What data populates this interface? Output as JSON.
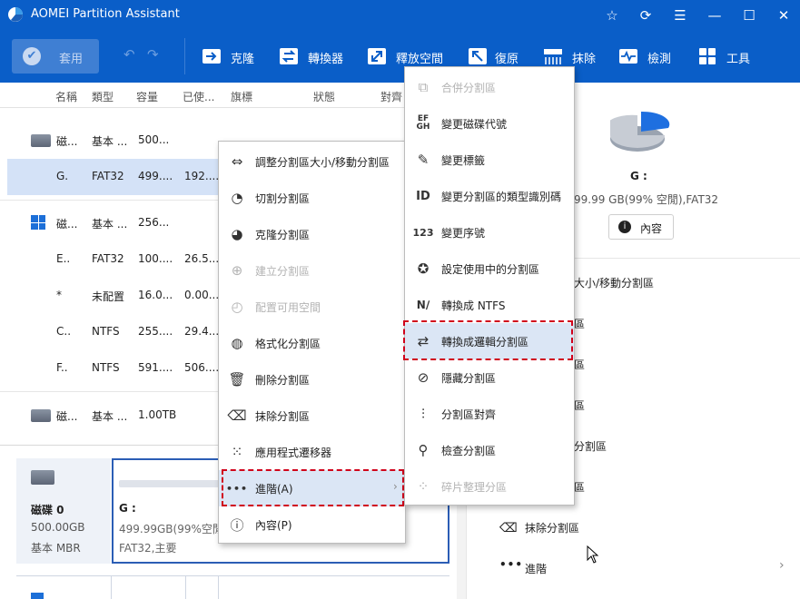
{
  "app": {
    "title": "AOMEI Partition Assistant"
  },
  "toolbar": {
    "apply": "套用",
    "items": [
      "克隆",
      "轉換器",
      "釋放空間",
      "復原",
      "抹除",
      "檢測",
      "工具"
    ]
  },
  "columns": [
    "名稱",
    "類型",
    "容量",
    "已使...",
    "旗標",
    "狀態",
    "對齊"
  ],
  "rows": [
    {
      "name": "磁...",
      "type": "基本 ...",
      "cap": "500...",
      "used": ""
    },
    {
      "name": "G.",
      "type": "FAT32",
      "cap": "499....",
      "used": "192...."
    },
    {
      "name": "磁...",
      "type": "基本 ...",
      "cap": "256...",
      "used": ""
    },
    {
      "name": "E..",
      "type": "FAT32",
      "cap": "100....",
      "used": "26.5..."
    },
    {
      "name": "*",
      "type": "未配置",
      "cap": "16.0...",
      "used": "0.00..."
    },
    {
      "name": "C..",
      "type": "NTFS",
      "cap": "255....",
      "used": "29.4..."
    },
    {
      "name": "F..",
      "type": "NTFS",
      "cap": "591....",
      "used": "506...."
    },
    {
      "name": "磁...",
      "type": "基本 ...",
      "cap": "1.00TB",
      "used": ""
    }
  ],
  "diskmap": {
    "disk_name": "磁碟 0",
    "disk_size": "500.00GB",
    "disk_type": "基本 MBR",
    "part_name": "G :",
    "part_size": "499.99GB(99%空閒",
    "part_fs": "FAT32,主要"
  },
  "rightpanel": {
    "part_name": "G :",
    "part_info": "99.99 GB(99% 空閒),FAT32",
    "prop_button": "內容",
    "ops": [
      "大小/移動分割區",
      "區",
      "區",
      "區",
      "分割區",
      "區",
      "區"
    ],
    "erase": "抹除分割區",
    "advanced": "進階"
  },
  "menu1": [
    {
      "label": "調整分割區大小/移動分割區",
      "enabled": true,
      "icon": "resize-icon"
    },
    {
      "label": "切割分割區",
      "enabled": true,
      "icon": "split-icon"
    },
    {
      "label": "克隆分割區",
      "enabled": true,
      "icon": "clone-icon"
    },
    {
      "label": "建立分割區",
      "enabled": false,
      "icon": "create-icon"
    },
    {
      "label": "配置可用空間",
      "enabled": false,
      "icon": "allocate-icon"
    },
    {
      "label": "格式化分割區",
      "enabled": true,
      "icon": "format-icon"
    },
    {
      "label": "刪除分割區",
      "enabled": true,
      "icon": "trash-icon"
    },
    {
      "label": "抹除分割區",
      "enabled": true,
      "icon": "eraser-icon"
    },
    {
      "label": "應用程式遷移器",
      "enabled": true,
      "icon": "apps-icon"
    },
    {
      "label": "進階(A)",
      "enabled": true,
      "icon": "more-icon"
    },
    {
      "label": "內容(P)",
      "enabled": true,
      "icon": "info-icon"
    }
  ],
  "menu2": [
    {
      "label": "合併分割區",
      "enabled": false,
      "icon": "merge-icon"
    },
    {
      "label": "變更磁碟代號",
      "enabled": true,
      "icon": "drive-letter-icon"
    },
    {
      "label": "變更標籤",
      "enabled": true,
      "icon": "pencil-icon"
    },
    {
      "label": "變更分割區的類型識別碼",
      "enabled": true,
      "icon": "id-icon"
    },
    {
      "label": "變更序號",
      "enabled": true,
      "icon": "serial-icon"
    },
    {
      "label": "設定使用中的分割區",
      "enabled": true,
      "icon": "active-icon"
    },
    {
      "label": "轉換成 NTFS",
      "enabled": true,
      "icon": "ntfs-icon"
    },
    {
      "label": "轉換成邏輯分割區",
      "enabled": true,
      "icon": "convert-icon"
    },
    {
      "label": "隱藏分割區",
      "enabled": true,
      "icon": "hide-icon"
    },
    {
      "label": "分割區對齊",
      "enabled": true,
      "icon": "align-icon"
    },
    {
      "label": "檢查分割區",
      "enabled": true,
      "icon": "search-icon"
    },
    {
      "label": "碎片整理分區",
      "enabled": false,
      "icon": "defrag-icon"
    }
  ]
}
